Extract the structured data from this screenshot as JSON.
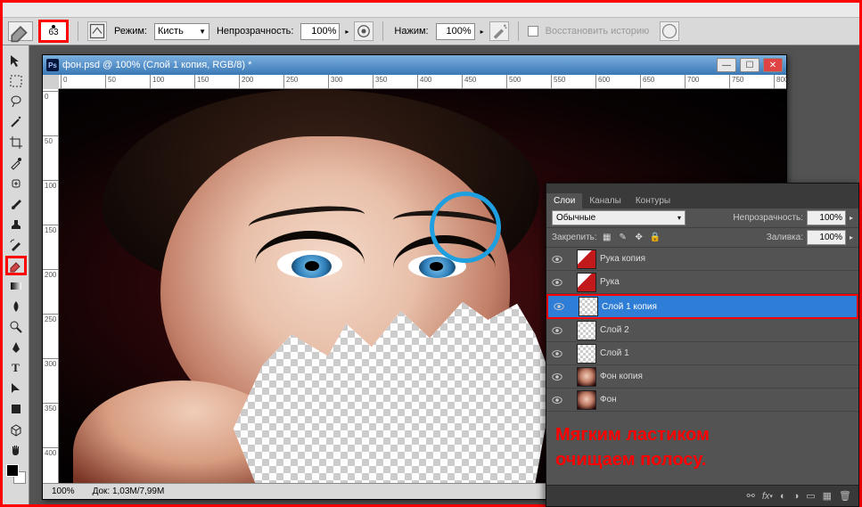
{
  "options_bar": {
    "brush_size": "63",
    "mode_label": "Режим:",
    "mode_value": "Кисть",
    "opacity_label": "Непрозрачность:",
    "opacity_value": "100%",
    "flow_label": "Нажим:",
    "flow_value": "100%",
    "history_label": "Восстановить историю"
  },
  "document": {
    "title": "фон.psd @ 100% (Слой 1 копия, RGB/8) *",
    "zoom": "100%",
    "docinfo": "Док: 1,03M/7,99M",
    "ruler_h": [
      "0",
      "50",
      "100",
      "150",
      "200",
      "250",
      "300",
      "350",
      "400",
      "450",
      "500",
      "550",
      "600",
      "650",
      "700",
      "750",
      "800"
    ],
    "ruler_v": [
      "0",
      "50",
      "100",
      "150",
      "200",
      "250",
      "300",
      "350",
      "400"
    ]
  },
  "panel": {
    "tabs": [
      "Слои",
      "Каналы",
      "Контуры"
    ],
    "active_tab": 0,
    "blend_mode": "Обычные",
    "opacity_label": "Непрозрачность:",
    "opacity_value": "100%",
    "lock_label": "Закрепить:",
    "fill_label": "Заливка:",
    "fill_value": "100%",
    "layers": [
      {
        "name": "Рука копия",
        "thumb": "hand",
        "active": false
      },
      {
        "name": "Рука",
        "thumb": "hand",
        "active": false
      },
      {
        "name": "Слой 1 копия",
        "thumb": "check",
        "active": true
      },
      {
        "name": "Слой 2",
        "thumb": "check",
        "active": false
      },
      {
        "name": "Слой 1",
        "thumb": "check",
        "active": false
      },
      {
        "name": "Фон копия",
        "thumb": "face",
        "active": false
      },
      {
        "name": "Фон",
        "thumb": "face",
        "active": false
      }
    ]
  },
  "annotation": {
    "line1": "Мягким ластиком",
    "line2": "очищаем полосу."
  }
}
